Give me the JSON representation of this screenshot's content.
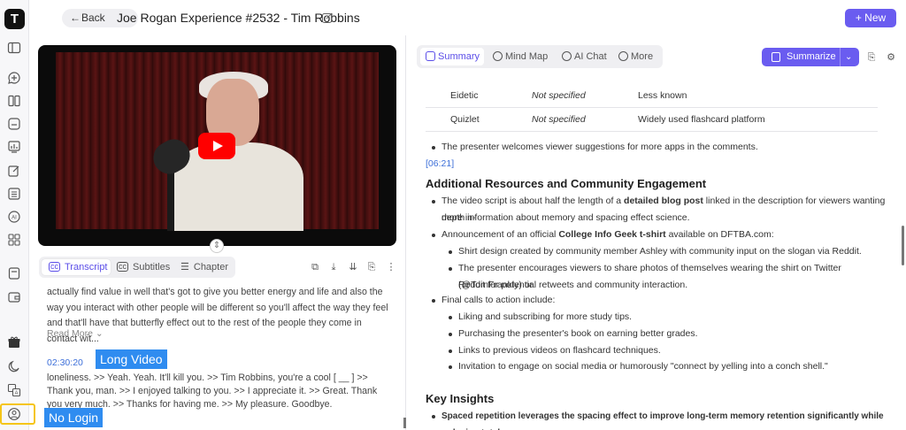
{
  "sidebar": {
    "logo": "T",
    "icons": [
      "sidebar-toggle-icon",
      "chat-add-icon",
      "book-icon",
      "history-icon",
      "chart-icon",
      "edit-note-icon",
      "list-icon",
      "ai-icon",
      "grid-icon",
      "notes-icon",
      "wallet-icon",
      "gift-icon",
      "moon-icon",
      "translate-icon",
      "user-icon"
    ]
  },
  "header": {
    "back_label": "Back",
    "title": "Joe Rogan Experience #2532 - Tim Robbins",
    "new_label": "New"
  },
  "left": {
    "tabs": [
      {
        "label": "Transcript",
        "icon": "cc-icon"
      },
      {
        "label": "Subtitles",
        "icon": "cc-icon"
      },
      {
        "label": "Chapter",
        "icon": "list-icon"
      }
    ],
    "transcript_text": "actually find value in well that's got to give you better energy and life and also the way you interact with other people will be different so you'll affect the way they feel and that'll have that butterfly effect out to the rest of the people they come in contact wit...",
    "read_more": "Read More",
    "timestamp": "02:30:20",
    "transcript_text_2": "loneliness. >> Yeah. Yeah. It'll kill you. >> Tim Robbins, you're a cool [ __ ] >> Thank you, man. >> I enjoyed talking to you. >> I appreciate it. >> Great. Thank you very much. >> Thanks for having me. >> My pleasure. Goodbye."
  },
  "annotations": {
    "long_video": "Long Video",
    "no_login": "No Login"
  },
  "right": {
    "tabs": [
      {
        "label": "Summary",
        "icon": "summary-icon"
      },
      {
        "label": "Mind Map",
        "icon": "mindmap-icon"
      },
      {
        "label": "AI Chat",
        "icon": "ai-chat-icon"
      },
      {
        "label": "More",
        "icon": "more-icon"
      }
    ],
    "summarize_label": "Summarize",
    "table_rows": [
      {
        "app": "Eidetic",
        "price": "Not specified",
        "note": "Less known"
      },
      {
        "app": "Quizlet",
        "price": "Not specified",
        "note": "Widely used flashcard platform"
      }
    ],
    "bullet_suggestions": "The presenter welcomes viewer suggestions for more apps in the comments.",
    "stamp": "[06:21]",
    "heading_resources": "Additional Resources and Community Engagement",
    "b1_pre": "The video script is about half the length of a ",
    "b1_bold": "detailed blog post",
    "b1_post": " linked in the description for viewers wanting more in-",
    "b1_line2": "depth information about memory and spacing effect science.",
    "b2_pre": "Announcement of an official ",
    "b2_bold": "College Info Geek t-shirt",
    "b2_post": " available on DFTBA.com:",
    "b2_sub1": "Shirt design created by community member Ashley with community input on the slogan via Reddit.",
    "b2_sub2_l1": "The presenter encourages viewers to share photos of themselves wearing the shirt on Twitter (@TomFrankly) or",
    "b2_sub2_l2": "Reddit for potential retweets and community interaction.",
    "b3": "Final calls to action include:",
    "b3_subs": [
      "Liking and subscribing for more study tips.",
      "Purchasing the presenter's book on earning better grades.",
      "Links to previous videos on flashcard techniques.",
      "Invitation to engage on social media or humorously \"connect by yelling into a conch shell.\""
    ],
    "heading_insights": "Key Insights",
    "insight1": "Spaced repetition leverages the spacing effect to improve long-term memory retention significantly while reducing total"
  },
  "colors": {
    "accent": "#6a5cf0",
    "link": "#3d6fd9",
    "annotation": "#2f8cf0",
    "highlight_box": "#f5c518"
  }
}
